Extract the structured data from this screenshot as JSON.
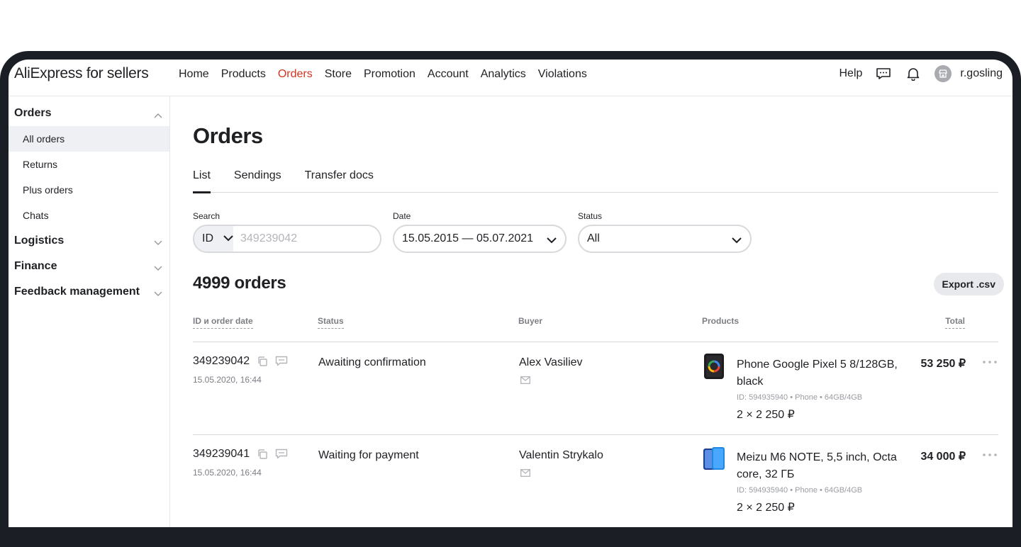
{
  "header": {
    "logo": "AliExpress for sellers",
    "nav": [
      "Home",
      "Products",
      "Orders",
      "Store",
      "Promotion",
      "Account",
      "Analytics",
      "Violations"
    ],
    "help": "Help",
    "username": "r.gosling"
  },
  "sidebar": {
    "groups": [
      {
        "label": "Orders",
        "expanded": true,
        "items": [
          "All orders",
          "Returns",
          "Plus orders",
          "Chats"
        ]
      },
      {
        "label": "Logistics",
        "expanded": false
      },
      {
        "label": "Finance",
        "expanded": false
      },
      {
        "label": "Feedback management",
        "expanded": false
      }
    ]
  },
  "main": {
    "title": "Orders",
    "tabs": [
      "List",
      "Sendings",
      "Transfer docs"
    ],
    "filters": {
      "search_label": "Search",
      "search_type": "ID",
      "search_placeholder": "349239042",
      "date_label": "Date",
      "date_value": "15.05.2015 — 05.07.2021",
      "status_label": "Status",
      "status_value": "All"
    },
    "count": "4999 orders",
    "export_label": "Export .csv",
    "columns": [
      "ID и order date",
      "Status",
      "Buyer",
      "Products",
      "Total"
    ],
    "orders": [
      {
        "id": "349239042",
        "date": "15.05.2020, 16:44",
        "status": "Awaiting confirmation",
        "buyer": "Alex Vasiliev",
        "product": "Phone Google Pixel 5 8/128GB, black",
        "product_meta": "ID: 594935940 • Phone • 64GB/4GB",
        "qty": "2 × 2 250 ₽",
        "total": "53 250 ₽"
      },
      {
        "id": "349239041",
        "date": "15.05.2020, 16:44",
        "status": "Waiting for payment",
        "buyer": "Valentin Strykalo",
        "product": "Meizu M6 NOTE, 5,5 inch, Octa core, 32 ГБ",
        "product_meta": "ID: 594935940 • Phone • 64GB/4GB",
        "qty": "2 × 2 250 ₽",
        "total": "34 000 ₽"
      }
    ]
  },
  "colors": {
    "accent": "#d7321f",
    "frame": "#1c1e26",
    "muted": "#7c7e84",
    "divider": "#d8d9dc"
  }
}
